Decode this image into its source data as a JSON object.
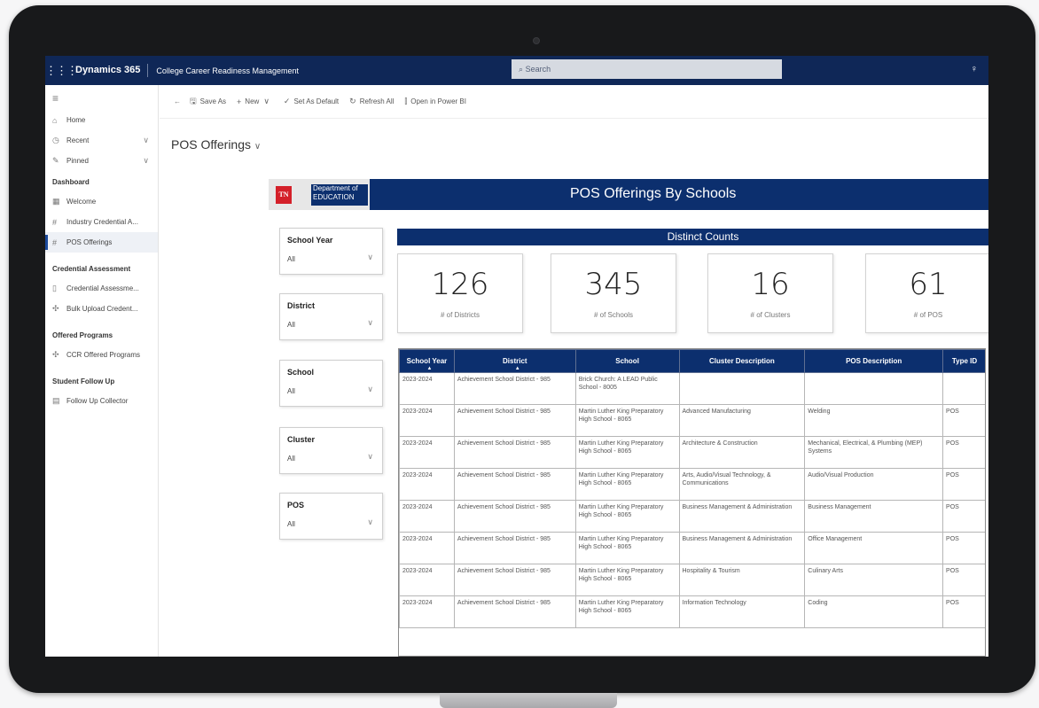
{
  "topbar": {
    "waffle_icon": "waffle-icon",
    "brand": "Dynamics 365",
    "app_name": "College Career Readiness Management",
    "search_placeholder": "Search"
  },
  "sidebar": {
    "items": [
      {
        "label": "Home",
        "icon": "home-icon"
      },
      {
        "label": "Recent",
        "icon": "clock-icon"
      },
      {
        "label": "Pinned",
        "icon": "pin-icon"
      }
    ],
    "groups": [
      {
        "title": "Dashboard",
        "items": [
          "Welcome",
          "Industry Credential A...",
          "POS Offerings"
        ]
      },
      {
        "title": "Credential Assessment",
        "items": [
          "Credential Assessme...",
          "Bulk Upload Credent..."
        ]
      },
      {
        "title": "Offered Programs",
        "items": [
          "CCR Offered Programs"
        ]
      },
      {
        "title": "Student Follow Up",
        "items": [
          "Follow Up Collector"
        ]
      }
    ]
  },
  "toolbar": {
    "save_as": "Save As",
    "new": "New",
    "set_default": "Set As Default",
    "refresh_all": "Refresh All",
    "open_power_bi": "Open in Power BI"
  },
  "page": {
    "title": "POS Offerings"
  },
  "report": {
    "logo_text_1": "Department of",
    "logo_text_2": "EDUCATION",
    "logo_badge": "TN",
    "title": "POS Offerings By Schools",
    "distinct_counts": "Distinct Counts",
    "slicers": [
      {
        "label": "School Year",
        "value": "All"
      },
      {
        "label": "District",
        "value": "All"
      },
      {
        "label": "School",
        "value": "All"
      },
      {
        "label": "Cluster",
        "value": "All"
      },
      {
        "label": "POS",
        "value": "All"
      }
    ],
    "cards": [
      {
        "value": "126",
        "label": "# of Districts"
      },
      {
        "value": "345",
        "label": "# of Schools"
      },
      {
        "value": "16",
        "label": "# of Clusters"
      },
      {
        "value": "61",
        "label": "# of POS"
      }
    ],
    "table": {
      "headers": [
        "School Year",
        "District",
        "School",
        "Cluster Description",
        "POS Description",
        "Type ID"
      ],
      "rows": [
        [
          "2023-2024",
          "Achievement School District - 985",
          "Brick Church: A LEAD Public School - 8005",
          "",
          "",
          ""
        ],
        [
          "2023-2024",
          "Achievement School District - 985",
          "Martin Luther King Preparatory High School - 8065",
          "Advanced Manufacturing",
          "Welding",
          "POS"
        ],
        [
          "2023-2024",
          "Achievement School District - 985",
          "Martin Luther King Preparatory High School - 8065",
          "Architecture & Construction",
          "Mechanical, Electrical, & Plumbing (MEP) Systems",
          "POS"
        ],
        [
          "2023-2024",
          "Achievement School District - 985",
          "Martin Luther King Preparatory High School - 8065",
          "Arts, Audio/Visual Technology, & Communications",
          "Audio/Visual Production",
          "POS"
        ],
        [
          "2023-2024",
          "Achievement School District - 985",
          "Martin Luther King Preparatory High School - 8065",
          "Business Management & Administration",
          "Business Management",
          "POS"
        ],
        [
          "2023-2024",
          "Achievement School District - 985",
          "Martin Luther King Preparatory High School - 8065",
          "Business Management & Administration",
          "Office Management",
          "POS"
        ],
        [
          "2023-2024",
          "Achievement School District - 985",
          "Martin Luther King Preparatory High School - 8065",
          "Hospitality & Tourism",
          "Culinary Arts",
          "POS"
        ],
        [
          "2023-2024",
          "Achievement School District - 985",
          "Martin Luther King Preparatory High School - 8065",
          "Information Technology",
          "Coding",
          "POS"
        ]
      ]
    }
  }
}
